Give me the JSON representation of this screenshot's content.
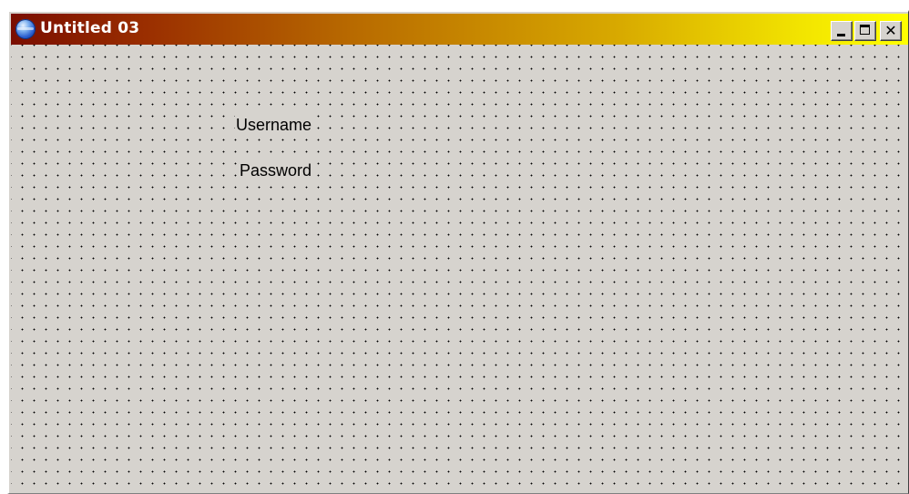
{
  "window": {
    "title": "Untitled 03",
    "icon": "globe-icon"
  },
  "caption_buttons": {
    "minimize": "minimize-icon",
    "maximize": "maximize-icon",
    "close_label": "✕",
    "close": "close-icon"
  },
  "form": {
    "labels": [
      {
        "text": "Username"
      },
      {
        "text": "Password"
      }
    ]
  },
  "colors": {
    "title_gradient_start": "#7a0e00",
    "title_gradient_end": "#ffff00",
    "face": "#d6d3ce",
    "title_text": "#ffffff"
  }
}
